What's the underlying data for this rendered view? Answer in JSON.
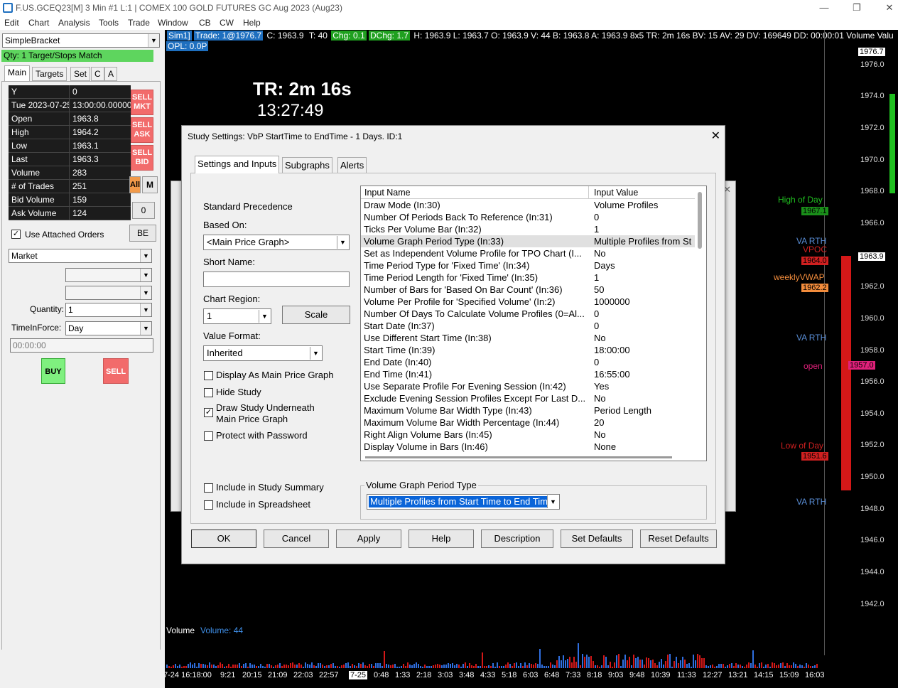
{
  "window": {
    "title": "F.US.GCEQ23[M]  3 Min   #1 L:1 | COMEX 100 GOLD FUTURES GC Aug 2023 (Aug23)"
  },
  "menu": [
    "Edit",
    "Chart",
    "Analysis",
    "Tools",
    "Trade",
    "Window",
    "CB",
    "CW",
    "Help"
  ],
  "trade_panel": {
    "bracket": "SimpleBracket",
    "qty_status": "Qty: 1 Target/Stops Match",
    "tabs": [
      "Main",
      "Targets",
      "Set",
      "C",
      "A"
    ],
    "info": [
      {
        "k": "Y",
        "v": "0"
      },
      {
        "k": "Tue 2023-07-25",
        "v": "13:00:00.000000"
      },
      {
        "k": "Open",
        "v": "1963.8"
      },
      {
        "k": "High",
        "v": "1964.2"
      },
      {
        "k": "Low",
        "v": "1963.1"
      },
      {
        "k": "Last",
        "v": "1963.3"
      },
      {
        "k": "Volume",
        "v": "283"
      },
      {
        "k": "# of Trades",
        "v": "251"
      },
      {
        "k": "Bid Volume",
        "v": "159"
      },
      {
        "k": "Ask Volume",
        "v": "124"
      }
    ],
    "sell_mkt": [
      "SELL",
      "MKT"
    ],
    "sell_ask": [
      "SELL",
      "ASK"
    ],
    "sell_bid": [
      "SELL",
      "BID"
    ],
    "all_label": "All",
    "m_label": "M",
    "zero_label": "0",
    "be_label": "BE",
    "use_attached_orders": "Use Attached Orders",
    "order_type": "Market",
    "quantity_label": "Quantity:",
    "quantity": "1",
    "tif_label": "TimeInForce:",
    "tif": "Day",
    "time_value": "00:00:00",
    "buy_label": "BUY",
    "sell_label": "SELL"
  },
  "chart": {
    "header": {
      "sim": "Sim1]",
      "trade": "Trade: 1@1976.7",
      "c": "C: 1963.9",
      "t": "T: 40",
      "chg": "Chg: 0.1",
      "dchg": "DChg: 1.7",
      "rest": "H: 1963.9 L: 1963.7 O: 1963.9 V: 44 B: 1963.8 A: 1963.9 8x5 TR: 2m 16s BV: 15 AV: 29 DV: 169649 DD: 00:00:01 Volume Valu",
      "opl": "OPL: 0.0P"
    },
    "tr_big": "TR: 2m 16s",
    "tr_time": "13:27:49",
    "price_labels": [
      "1976.0",
      "1974.0",
      "1972.0",
      "1970.0",
      "1968.0",
      "1966.0",
      "1962.0",
      "1960.0",
      "1958.0",
      "1956.0",
      "1954.0",
      "1952.0",
      "1950.0",
      "1948.0",
      "1946.0",
      "1944.0",
      "1942.0"
    ],
    "price_box_top": "1976.7",
    "price_box_current": "1963.9",
    "high_of_day": "High of Day",
    "high_of_day_val": "1967.1",
    "va_rth_1": "VA RTH",
    "vpoc": "VPOC",
    "vpoc_val": "1964.0",
    "weekly_vwap": "weeklyVWAP",
    "weekly_vwap_val": "1962.2",
    "va_rth_2": "VA RTH",
    "open": "open",
    "open_val": "1957.0",
    "low_of_day": "Low of Day",
    "low_of_day_val": "1951.6",
    "va_rth_3": "VA RTH",
    "volume_label": "Volume",
    "volume_value": "Volume: 44",
    "time_labels": [
      "7-24  16:18:00",
      "9:21",
      "20:15",
      "21:09",
      "22:03",
      "22:57",
      "7-25",
      "0:48",
      "1:33",
      "2:18",
      "3:03",
      "3:48",
      "4:33",
      "5:18",
      "6:03",
      "6:48",
      "7:33",
      "8:18",
      "9:03",
      "9:48",
      "10:39",
      "11:33",
      "12:27",
      "13:21",
      "14:15",
      "15:09",
      "16:03"
    ]
  },
  "dialog": {
    "title": "Study Settings: VbP StartTime to EndTime - 1 Days. ID:1",
    "tabs": [
      "Settings and Inputs",
      "Subgraphs",
      "Alerts"
    ],
    "standard_precedence": "Standard Precedence",
    "based_on_label": "Based On:",
    "based_on": "<Main Price Graph>",
    "short_name_label": "Short Name:",
    "short_name": "",
    "chart_region_label": "Chart Region:",
    "chart_region": "1",
    "scale_label": "Scale",
    "value_format_label": "Value Format:",
    "value_format": "Inherited",
    "display_as_main": "Display As Main Price Graph",
    "hide_study": "Hide Study",
    "draw_underneath_1": "Draw Study Underneath",
    "draw_underneath_2": "Main Price Graph",
    "protect_password": "Protect with Password",
    "include_summary": "Include in Study Summary",
    "include_spreadsheet": "Include in Spreadsheet",
    "col_name": "Input Name",
    "col_value": "Input Value",
    "inputs": [
      {
        "n": "Draw Mode   (In:30)",
        "v": "Volume Profiles"
      },
      {
        "n": "Number Of Periods Back To Reference   (In:31)",
        "v": "0"
      },
      {
        "n": "Ticks Per Volume Bar   (In:32)",
        "v": "1"
      },
      {
        "n": "Volume Graph Period Type   (In:33)",
        "v": "Multiple Profiles from St"
      },
      {
        "n": "Set as Independent Volume Profile for TPO Chart   (I...",
        "v": "No"
      },
      {
        "n": "Time Period Type for 'Fixed Time'   (In:34)",
        "v": "Days"
      },
      {
        "n": "Time Period Length for 'Fixed Time'   (In:35)",
        "v": "1"
      },
      {
        "n": "Number of Bars for 'Based On Bar Count'   (In:36)",
        "v": "50"
      },
      {
        "n": "Volume Per Profile for 'Specified Volume'   (In:2)",
        "v": "1000000"
      },
      {
        "n": "Number Of Days To Calculate Volume Profiles (0=Al...",
        "v": "0"
      },
      {
        "n": "Start Date   (In:37)",
        "v": "0"
      },
      {
        "n": "Use Different Start Time   (In:38)",
        "v": "No"
      },
      {
        "n": "Start Time   (In:39)",
        "v": "18:00:00"
      },
      {
        "n": "End Date   (In:40)",
        "v": "0"
      },
      {
        "n": "End Time   (In:41)",
        "v": "16:55:00"
      },
      {
        "n": "Use Separate Profile For Evening Session   (In:42)",
        "v": "Yes"
      },
      {
        "n": "Exclude Evening Session Profiles Except For Last D...",
        "v": "No"
      },
      {
        "n": "Maximum Volume Bar Width Type   (In:43)",
        "v": "Period Length"
      },
      {
        "n": "Maximum Volume Bar Width Percentage   (In:44)",
        "v": "20"
      },
      {
        "n": "Right Align Volume Bars   (In:45)",
        "v": "No"
      },
      {
        "n": "Display Volume in Bars   (In:46)",
        "v": "None"
      }
    ],
    "selected_input_title": "Volume Graph Period Type",
    "selected_input_value": "Multiple Profiles from Start Time to End Tim",
    "buttons": {
      "ok": "OK",
      "cancel": "Cancel",
      "apply": "Apply",
      "help": "Help",
      "description": "Description",
      "set_defaults": "Set Defaults",
      "reset_defaults": "Reset Defaults"
    }
  }
}
